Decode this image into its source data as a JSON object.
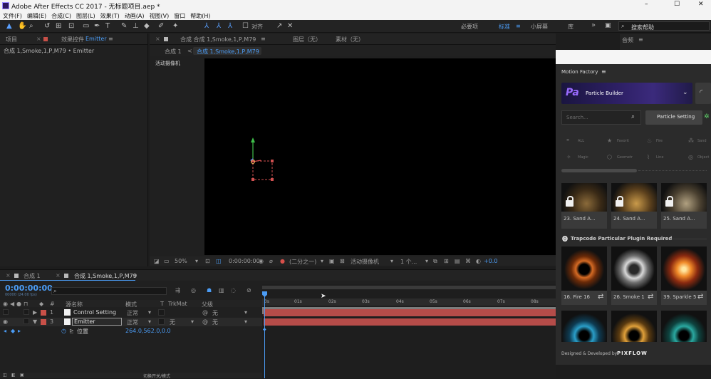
{
  "titlebar": {
    "title": "Adobe After Effects CC 2017 - 无标题项目.aep *",
    "minimize": "–",
    "maximize": "☐",
    "close": "✕"
  },
  "menu": [
    "文件(F)",
    "编辑(E)",
    "合成(C)",
    "图层(L)",
    "效果(T)",
    "动画(A)",
    "视图(V)",
    "窗口",
    "帮助(H)"
  ],
  "toolbar": {
    "align_label": "对齐",
    "workspaces": [
      "必要项",
      "标准",
      "小屏幕",
      "库"
    ],
    "active_workspace": "标准",
    "overflow": "»",
    "search_placeholder": "搜索帮助"
  },
  "project_panel": {
    "tab_project": "项目",
    "tab_effects": "效果控件 Emitter",
    "effects_prefix": "效果控件",
    "effects_target": "Emitter",
    "breadcrumb": "合成 1,Smoke,1,P,M79 • Emitter"
  },
  "comp_panel": {
    "tab_comp": "合成 合成 1,Smoke,1,P,M79",
    "tab_layer": "图层（无）",
    "tab_footage": "素材（无）",
    "crumb_1": "合成 1",
    "crumb_2": "合成 1,Smoke,1,P,M79",
    "camera_label": "活动摄像机"
  },
  "viewer_bar": {
    "zoom": "50%",
    "timecode": "0:00:00:00",
    "resolution": "(二分之一)",
    "camera": "活动摄像机",
    "views": "1 个...",
    "exposure": "+0.0"
  },
  "timeline": {
    "tab_comp1": "合成 1",
    "tab_comp2": "合成 1,Smoke,1,P,M79",
    "timecode": "0:00:00:00",
    "fps": "00000 (24.00 fps)",
    "columns": {
      "num": "#",
      "source": "源名称",
      "mode": "模式",
      "t": "T",
      "trkmat": "TrkMat",
      "parent": "父级"
    },
    "layers": [
      {
        "num": "1",
        "name": "Control Setting",
        "mode": "正常",
        "trkmat": "",
        "parent": "无"
      },
      {
        "num": "3",
        "name": "Emitter",
        "mode": "正常",
        "trkmat": "无",
        "parent": "无"
      }
    ],
    "property": {
      "name": "位置",
      "value": "264.0,562.0,0.0"
    },
    "ruler": [
      "0s",
      "01s",
      "02s",
      "03s",
      "04s",
      "05s",
      "06s",
      "07s",
      "08s"
    ],
    "bottom_label": "切换开关/模式"
  },
  "motion_factory": {
    "title": "Motion Factory",
    "builder": "Particle Builder",
    "search_placeholder": "Search...",
    "setting_button": "Particle Setting",
    "categories": [
      "ALL",
      "Favorit",
      "Fire",
      "Sand",
      "Magic",
      "Geometr",
      "Line",
      "Object"
    ],
    "locked_items": [
      "23. Sand A...",
      "24. Sand A...",
      "25. Sand A..."
    ],
    "required_label": "Trapcode Particular Plugin Required",
    "items": [
      "16. Fire 16",
      "26. Smoke 1",
      "39. Sparkle 5"
    ],
    "footer_prefix": "Designed & Developed by",
    "footer_brand": "PIXFLOW"
  },
  "right_panel": {
    "tab": "音频"
  },
  "colors": {
    "accent": "#4b9cf5",
    "layer_red": "#c85048",
    "track_red": "#b54c49",
    "mf_purple": "#8b5cf6"
  }
}
